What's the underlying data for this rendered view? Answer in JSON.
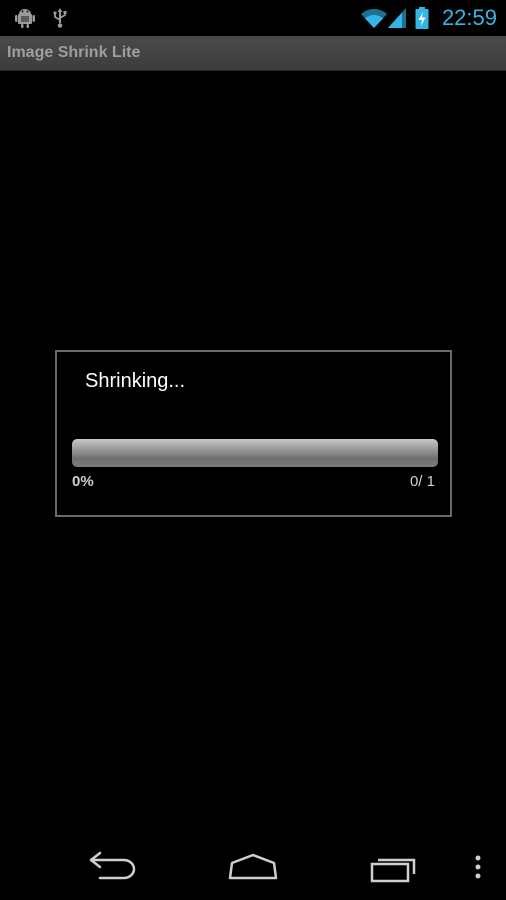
{
  "status_bar": {
    "left_icons": [
      "android-debug-icon",
      "usb-icon"
    ],
    "right_icons": [
      "wifi-icon",
      "signal-icon",
      "battery-charging-icon"
    ],
    "time": "22:59",
    "accent_color": "#33b5e5"
  },
  "app": {
    "title": "Image Shrink Lite"
  },
  "dialog": {
    "message": "Shrinking...",
    "progress_percent_label": "0%",
    "progress_count_label": "0/ 1",
    "progress_fraction": 0
  },
  "nav_bar": {
    "buttons": [
      "back-icon",
      "home-icon",
      "recent-apps-icon",
      "overflow-menu-icon"
    ]
  }
}
